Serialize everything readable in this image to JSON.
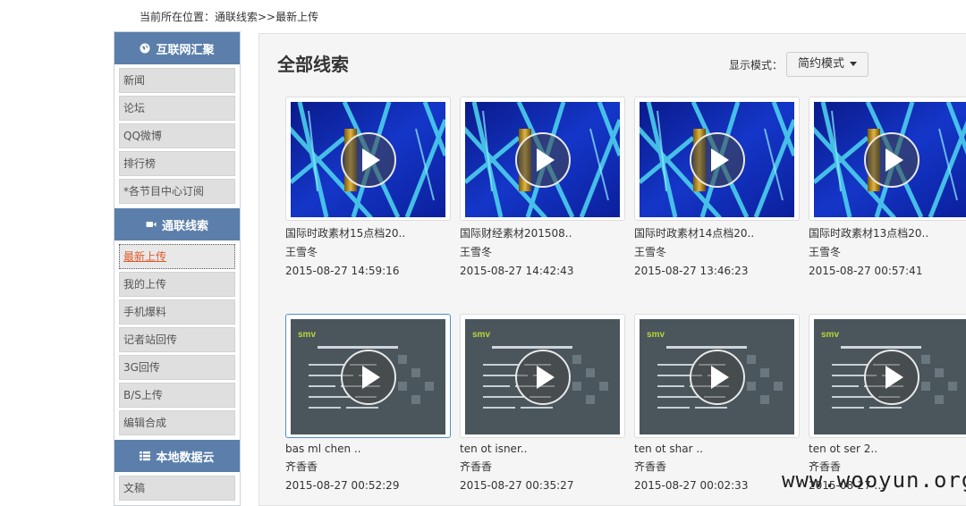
{
  "breadcrumb": "当前所在位置：通联线索>>最新上传",
  "sidebar": {
    "sections": [
      {
        "title": "互联网汇聚",
        "icon": "globe-icon",
        "items": [
          "新闻",
          "论坛",
          "QQ微博",
          "排行榜",
          "*各节目中心订阅"
        ]
      },
      {
        "title": "通联线索",
        "icon": "video-camera-icon",
        "items": [
          "最新上传",
          "我的上传",
          "手机爆料",
          "记者站回传",
          "3G回传",
          "B/S上传",
          "编辑合成"
        ]
      },
      {
        "title": "本地数据云",
        "icon": "list-icon",
        "items": [
          "文稿"
        ]
      }
    ],
    "active_item": "最新上传"
  },
  "main": {
    "title": "全部线索",
    "display_mode_label": "显示模式：",
    "display_mode_value": "简约模式"
  },
  "videos": [
    {
      "title": "国际时政素材15点档20..",
      "author": "王雪冬",
      "date": "2015-08-27 14:59:16",
      "thumb": "blue"
    },
    {
      "title": "国际财经素材201508..",
      "author": "王雪冬",
      "date": "2015-08-27 14:42:43",
      "thumb": "blue"
    },
    {
      "title": "国际时政素材14点档20..",
      "author": "王雪冬",
      "date": "2015-08-27 13:46:23",
      "thumb": "blue"
    },
    {
      "title": "国际时政素材13点档20..",
      "author": "王雪冬",
      "date": "2015-08-27 00:57:41",
      "thumb": "blue"
    },
    {
      "title": "bas ml chen ..",
      "author": "齐香香",
      "date": "2015-08-27 00:52:29",
      "thumb": "gray",
      "selected": true
    },
    {
      "title": "ten ot isner..",
      "author": "齐香香",
      "date": "2015-08-27 00:35:27",
      "thumb": "gray"
    },
    {
      "title": "ten ot shar ..",
      "author": "齐香香",
      "date": "2015-08-27 00:02:33",
      "thumb": "gray"
    },
    {
      "title": "ten ot ser 2..",
      "author": "齐香香",
      "date": "2015-08-27 ...",
      "thumb": "gray"
    }
  ],
  "watermark": "www.wooyun.org"
}
